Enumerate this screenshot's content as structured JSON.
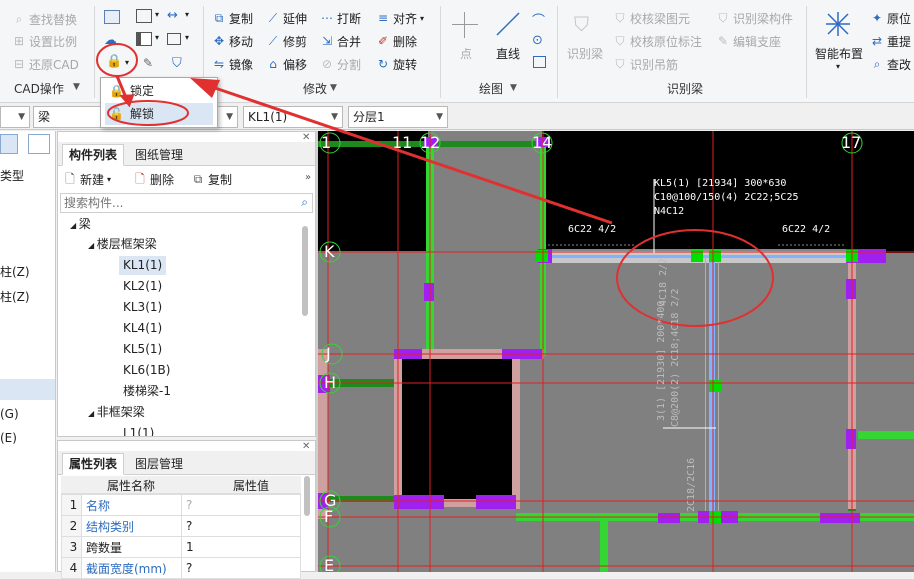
{
  "ribbon": {
    "cad_ops": {
      "items": [
        "查找替换",
        "设置比例",
        "还原CAD"
      ],
      "label": "CAD操作"
    },
    "edit": {
      "items": [
        "复制",
        "延伸",
        "打断",
        "对齐",
        "移动",
        "修剪",
        "合并",
        "删除",
        "镜像",
        "偏移",
        "分割",
        "旋转"
      ],
      "label": "修改"
    },
    "draw": {
      "items": [
        "点",
        "直线"
      ],
      "label": "绘图"
    },
    "recognize": {
      "items": [
        "识别梁",
        "校核梁图元",
        "识别梁构件",
        "校核原位标注",
        "编辑支座",
        "识别吊筋"
      ],
      "label": "识别梁"
    },
    "right": {
      "items": [
        "智能布置",
        "原位",
        "重提",
        "查改"
      ]
    }
  },
  "lock_menu": {
    "items": [
      "锁定",
      "解锁"
    ],
    "highlighted": "解锁"
  },
  "toolbar": {
    "combos": [
      "梁",
      "KL1(1)",
      "分层1"
    ]
  },
  "left_strip": {
    "items": [
      "类型",
      "柱(Z)",
      "柱(Z)",
      "(G)",
      "(E)"
    ]
  },
  "component_panel": {
    "tabs": [
      "构件列表",
      "图纸管理"
    ],
    "actions": [
      "新建",
      "删除",
      "复制"
    ],
    "search_placeholder": "搜索构件...",
    "tree": {
      "root": "梁",
      "group1": "楼层框架梁",
      "items": [
        "KL1(1)",
        "KL2(1)",
        "KL3(1)",
        "KL4(1)",
        "KL5(1)",
        "KL6(1B)",
        "楼梯梁-1"
      ],
      "selected": "KL1(1)",
      "group2": "非框架梁",
      "group2_items": [
        "L1(1)"
      ]
    }
  },
  "property_panel": {
    "tabs": [
      "属性列表",
      "图层管理"
    ],
    "headers": [
      "属性名称",
      "属性值"
    ],
    "rows": [
      {
        "num": "1",
        "name": "名称",
        "value": "?"
      },
      {
        "num": "2",
        "name": "结构类别",
        "value": "?"
      },
      {
        "num": "3",
        "name": "跨数量",
        "value": "1"
      },
      {
        "num": "4",
        "name": "截面宽度(mm)",
        "value": "?"
      }
    ]
  },
  "cad": {
    "axes_top": [
      "1",
      "11",
      "12",
      "14",
      "17"
    ],
    "axes_left": [
      "K",
      "J",
      "H",
      "G",
      "F",
      "E"
    ],
    "annotations": {
      "beam_kl5_1": "KL5(1) [21934] 300*630",
      "beam_kl5_2": "C10@100/150(4) 2C22;5C25",
      "beam_kl5_3": "N4C12",
      "left_rebar": "6C22 4/2",
      "right_rebar": "6C22 4/2",
      "vert_1": "4C18 2/2",
      "vert_2": "3(1) [21930] 200*400",
      "vert_3": "C8@200(2) 2C18;4C18 2/2",
      "vert_4": "2C18/2C16"
    },
    "colors": {
      "background": "#808080",
      "black_fill": "#000000",
      "green": "#33d633",
      "magenta": "#a020f0",
      "red_line": "#e02020",
      "highlight_blue": "#7fb2ff"
    }
  }
}
